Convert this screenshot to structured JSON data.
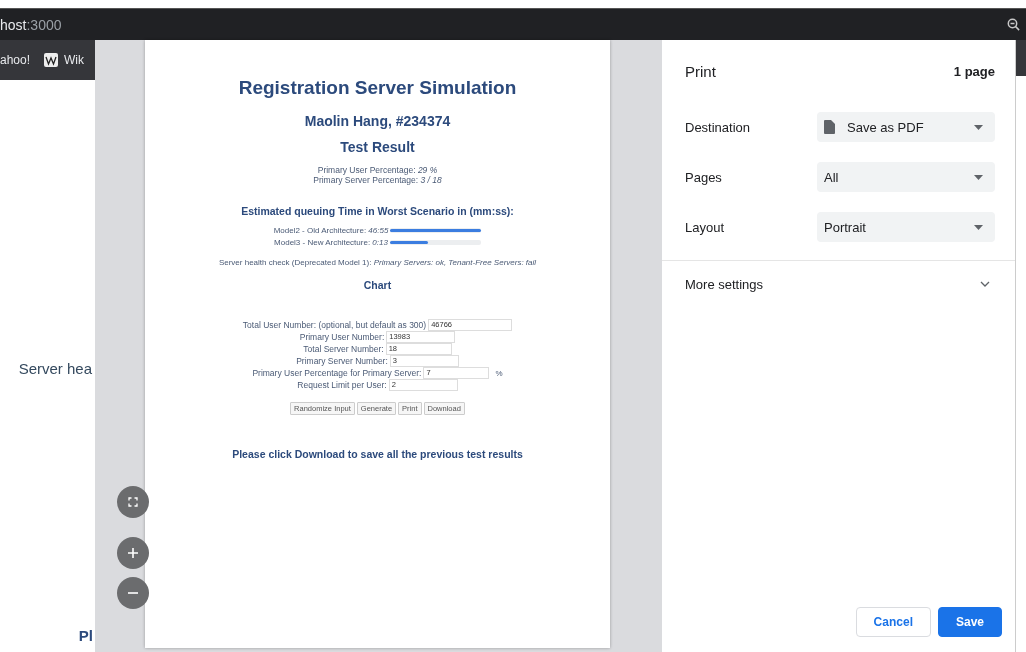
{
  "browser": {
    "address": {
      "host": "host",
      "port": ":3000"
    },
    "bookmarks": [
      {
        "label": "ahoo!",
        "kind": "text"
      },
      {
        "label": "Wik",
        "kind": "wiki"
      }
    ]
  },
  "background_page": {
    "texts": [
      {
        "text": "Server hea",
        "kind": "body"
      },
      {
        "text": "Pl",
        "kind": "heading"
      }
    ]
  },
  "preview": {
    "title": "Registration Server Simulation",
    "author": "Maolin Hang, #234374",
    "subtitle": "Test Result",
    "stats": [
      {
        "label": "Primary User Percentage: ",
        "value": "29 %"
      },
      {
        "label": "Primary Server Percentage: ",
        "value": "3 / 18"
      }
    ],
    "queue_heading": "Estimated queuing Time in Worst Scenario in (mm:ss):",
    "models": [
      {
        "label": "Model2 - Old Architecture: ",
        "value": "46:55",
        "level": 1
      },
      {
        "label": "Model3 - New Architecture: ",
        "value": "0:13",
        "level": 0.42
      }
    ],
    "health": {
      "label": "Server health check (Deprecated Model 1): ",
      "value": "Primary Servers: ok, Tenant-Free Servers: fail"
    },
    "chart_heading": "Chart",
    "fields": [
      {
        "label": "Total User Number: (optional, but default as 300)",
        "value": "46766"
      },
      {
        "label": "Primary User Number:",
        "value": "13983"
      },
      {
        "label": "Total Server Number:",
        "value": "18"
      },
      {
        "label": "Primary Server Number:",
        "value": "3"
      },
      {
        "label": "Primary User Percentage for Primary Server:",
        "value": "7",
        "suffix": "%"
      },
      {
        "label": "Request Limit per User:",
        "value": "2"
      }
    ],
    "buttons": [
      "Randomize Input",
      "Generate",
      "Print",
      "Download"
    ],
    "footer": "Please click Download to save all the previous test results"
  },
  "print": {
    "title": "Print",
    "page_count": "1 page",
    "settings": [
      {
        "label": "Destination",
        "value": "Save as PDF",
        "kind": "destination"
      },
      {
        "label": "Pages",
        "value": "All",
        "kind": "plain"
      },
      {
        "label": "Layout",
        "value": "Portrait",
        "kind": "plain"
      }
    ],
    "more": "More settings",
    "buttons": [
      {
        "label": "Cancel",
        "kind": "secondary"
      },
      {
        "label": "Save",
        "kind": "primary"
      }
    ]
  }
}
